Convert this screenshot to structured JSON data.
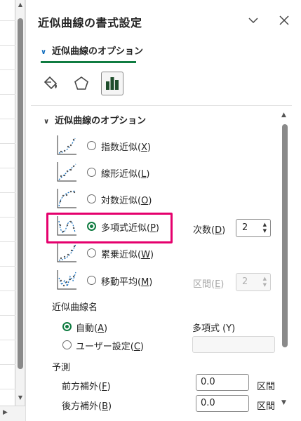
{
  "pane": {
    "title": "近似曲線の書式設定",
    "subtab_label": "近似曲線のオプション"
  },
  "section": {
    "title": "近似曲線のオプション"
  },
  "trend_types": [
    {
      "label": "指数近似(",
      "key": "X",
      "close": ")",
      "checked": false,
      "icon": "exponential-trend-icon"
    },
    {
      "label": "線形近似(",
      "key": "L",
      "close": ")",
      "checked": false,
      "icon": "linear-trend-icon"
    },
    {
      "label": "対数近似(",
      "key": "O",
      "close": ")",
      "checked": false,
      "icon": "logarithmic-trend-icon"
    },
    {
      "label": "多項式近似(",
      "key": "P",
      "close": ")",
      "checked": true,
      "icon": "polynomial-trend-icon"
    },
    {
      "label": "累乗近似(",
      "key": "W",
      "close": ")",
      "checked": false,
      "icon": "power-trend-icon"
    },
    {
      "label": "移動平均(",
      "key": "M",
      "close": ")",
      "checked": false,
      "icon": "moving-average-trend-icon"
    }
  ],
  "order": {
    "label": "次数(",
    "key": "D",
    "close": ")",
    "value": "2"
  },
  "period": {
    "label": "区間(",
    "key": "E",
    "close": ")",
    "value": "2"
  },
  "name_group": {
    "title": "近似曲線名",
    "auto_label": "自動(",
    "auto_key": "A",
    "auto_close": ")",
    "auto_value": "多項式 (Y)",
    "custom_label": "ユーザー設定(",
    "custom_key": "C",
    "custom_close": ")"
  },
  "forecast": {
    "title": "予測",
    "forward_label": "前方補外(",
    "forward_key": "F",
    "forward_close": ")",
    "forward_value": "0.0",
    "backward_label": "後方補外(",
    "backward_key": "B",
    "backward_close": ")",
    "backward_value": "0.0",
    "unit": "区間"
  },
  "colors": {
    "accent": "#107c41",
    "highlight": "#e5006d",
    "trend_line": "#0f6cbd"
  }
}
